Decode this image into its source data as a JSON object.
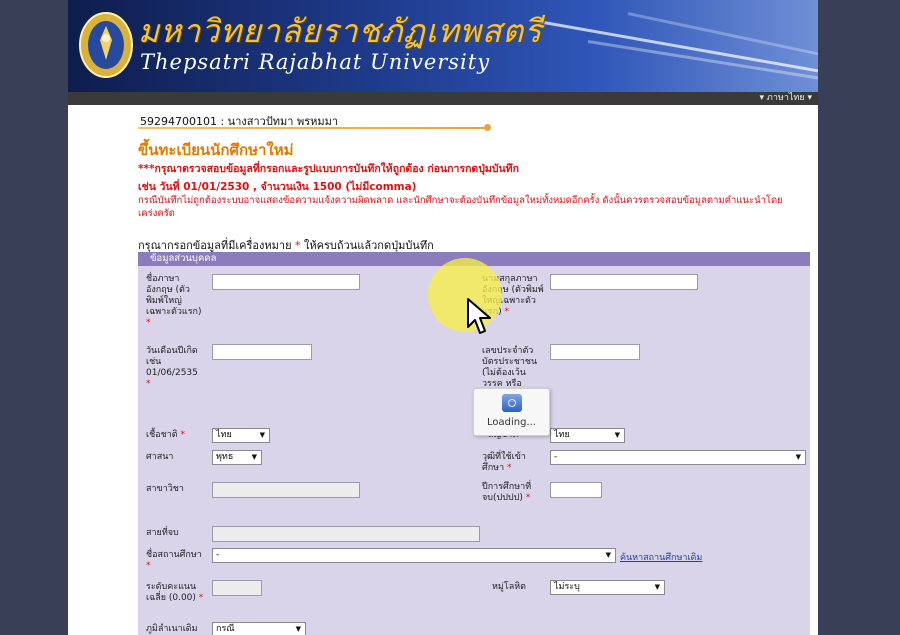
{
  "header": {
    "university_th": "มหาวิทยาลัยราชภัฏเทพสตรี",
    "university_en": "Thepsatri Rajabhat University",
    "language_menu": "▾ ภาษาไทย ▾"
  },
  "student": {
    "id_name": "59294700101 : นางสาวปัทมา พรหมมา"
  },
  "page": {
    "title": "ขึ้นทะเบียนนักศึกษาใหม่",
    "warning1": "***กรุณาตรวจสอบข้อมูลที่กรอกและรูปแบบการบันทึกให้ถูกต้อง ก่อนการกดปุ่มบันทึก",
    "warning2": "เช่น วันที่ 01/01/2530 , จำนวนเงิน 1500 (ไม่มีcomma)",
    "note": "กรณีบันทึกไม่ถูกต้องระบบอาจแสดงข้อความแจ้งความผิดพลาด และนักศึกษาจะต้องบันทึกข้อมูลใหม่ทั้งหมดอีกครั้ง ดังนั้นควรตรวจสอบข้อมูลตามคำแนะนำโดยเคร่งครัด",
    "required_prefix": "กรุณากรอกข้อมูลที่มีเครื่องหมาย",
    "required_star": "*",
    "required_suffix": "ให้ครบถ้วนแล้วกดปุ่มบันทึก",
    "section_title": "ข้อมูลส่วนบุคคล"
  },
  "form": {
    "first_name_en_label": "ชื่อภาษาอังกฤษ (ตัวพิมพ์ใหญ่เฉพาะตัวแรก)",
    "last_name_en_label": "นามสกุลภาษาอังกฤษ (ตัวพิมพ์ใหญ่เฉพาะตัวแรก)",
    "birthdate_label": "วันเดือนปีเกิด เช่น 01/06/2535",
    "id_card_label": "เลขประจำตัวบัตรประชาชน (ไม่ต้องเว้นวรรค หรือ -นะ)",
    "nationality_label": "เชื้อชาติ",
    "nationality_value": "ไทย",
    "citizenship_label": "สัญชาติ",
    "citizenship_value": "ไทย",
    "religion_label": "ศาสนา",
    "religion_value": "พุทธ",
    "admission_degree_label": "วุฒิที่ใช้เข้าศึกษา",
    "admission_degree_value": "-",
    "major_label": "สาขาวิชา",
    "grad_year_label": "ปีการศึกษาที่จบ(ปปปป)",
    "stream_label": "สายที่จบ",
    "school_label": "ชื่อสถานศึกษา",
    "school_value": "-",
    "school_search_link": "ค้นหาสถานศึกษาเดิม",
    "gpa_label": "ระดับคะแนนเฉลี่ย (0.00)",
    "disability_label": "หมู่โลหิต",
    "disability_value": "ไม่ระบุ",
    "origin_label": "ภูมิลำเนาเดิม",
    "origin_value": "กรณี"
  },
  "overlay": {
    "loading_text": "Loading..."
  },
  "colors": {
    "banner": "#1e3a8a",
    "title": "#e07b00",
    "warning": "#e01010",
    "section": "#8b7cbc",
    "form_bg": "#d9d4ea"
  }
}
